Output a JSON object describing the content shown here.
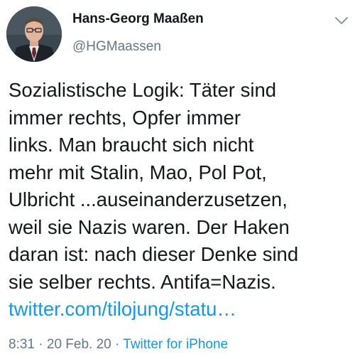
{
  "author": {
    "name": "Hans-Georg Maaßen",
    "handle": "@HGMaassen",
    "avatar_icon": "profile-photo"
  },
  "menu_icon": "chevron-down-icon",
  "tweet": {
    "lines": [
      "Sozialistische Logik: Täter sind",
      "immer rechts, Opfer immer",
      "links. Man braucht sich nicht",
      "mehr mit Stalin, Mao, Pol Pot,",
      "Ulbricht ...auseinanderzusetzen,",
      "weil sie Nazis waren. Der Haken",
      "daran ist: nach dieser Denke sind",
      "sie selber rechts. Antifa=Nazis."
    ],
    "link": "twitter.com/tilojung/statu…"
  },
  "meta": {
    "time": "8:31",
    "sep1": " · ",
    "date": "20 Feb. 20",
    "sep2": " · ",
    "source": "Twitter for iPhone"
  },
  "colors": {
    "link": "#1b95e0",
    "secondary": "#657786",
    "text": "#14171a"
  }
}
